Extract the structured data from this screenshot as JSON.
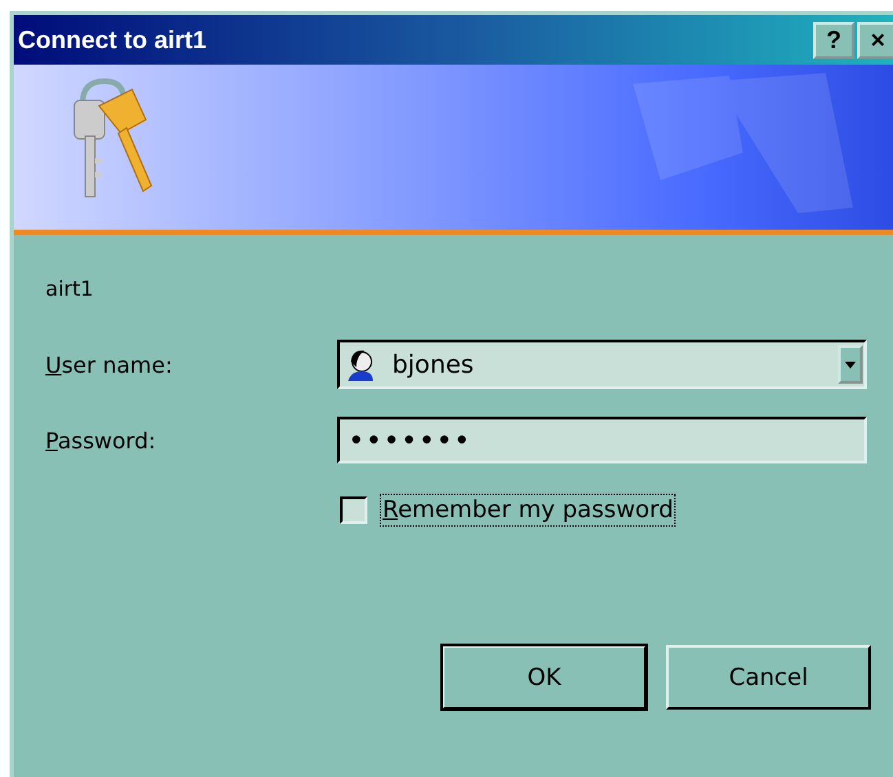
{
  "window": {
    "title": "Connect to airt1",
    "title_buttons": [
      "?",
      "×"
    ]
  },
  "server_name": "airt1",
  "fields": [
    {
      "kind": "combo",
      "mnemonic": "U",
      "label_rest": "ser name:",
      "value": "bjones"
    },
    {
      "kind": "password",
      "mnemonic": "P",
      "label_rest": "assword:",
      "value": "•••••••"
    }
  ],
  "remember": {
    "mnemonic": "R",
    "label_rest": "emember my password",
    "checked": false,
    "focused": true
  },
  "buttons": [
    {
      "label": "OK",
      "default": true
    },
    {
      "label": "Cancel",
      "default": false
    }
  ]
}
